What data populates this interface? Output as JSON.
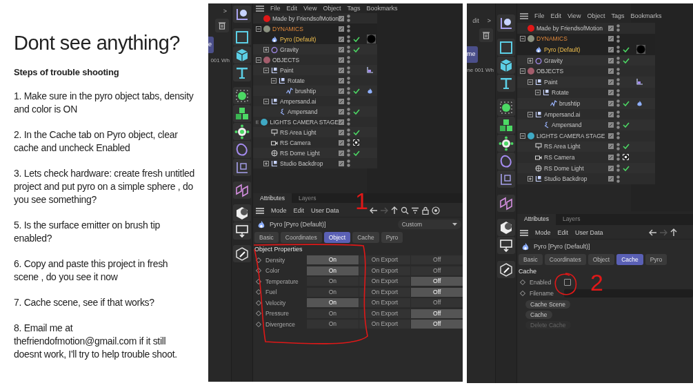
{
  "slide": {
    "title": "Dont see anything?",
    "subtitle": "Steps of trouble shooting",
    "steps": [
      "1. Make sure in the pyro object tabs, density and color is ON",
      "2. In the Cache tab on Pyro object, clear cache and uncheck Enabled",
      "3. Lets check hardware: create fresh untitled project and put pyro on a simple sphere , do you see something?",
      "5. Is the surface emitter on brush tip enabled?",
      "6. Copy and paste this project in fresh scene , do you see it now",
      "7. Cache scene, see if that works?",
      "8. Email me at thefriendofmotion@gmail.com if it still doesnt work, I'll try to help trouble shoot."
    ]
  },
  "shots": [
    {
      "strip": {
        "top": [
          ">"
        ],
        "button": "e",
        "caption": "001 Wh"
      },
      "menu": [
        "File",
        "Edit",
        "View",
        "Object",
        "Tags",
        "Bookmarks"
      ],
      "tree": [
        {
          "label": "Made by FriendsofMotion",
          "kind": "layer",
          "color": "#e01818",
          "selected": false
        },
        {
          "label": "DYNAMICS",
          "kind": "layer",
          "color": "#8b9180",
          "selected": true,
          "expanded": true,
          "children": [
            {
              "label": "Pyro (Default)",
              "kind": "flame",
              "selected": true,
              "enabled": true,
              "tags": [
                {
                  "kind": "material"
                }
              ]
            },
            {
              "label": "Gravity",
              "kind": "ring",
              "selected": false,
              "expanded": false,
              "enabled": true
            }
          ]
        },
        {
          "label": "OBJECTS",
          "kind": "layer",
          "color": "#a35d6c",
          "selected": false,
          "expanded": true,
          "children": [
            {
              "label": "Paint",
              "kind": "null",
              "selected": false,
              "expanded": true,
              "enabled": false,
              "tags": [
                {
                  "kind": "paint"
                }
              ],
              "children": [
                {
                  "label": "Rotate",
                  "kind": "null",
                  "selected": false,
                  "expanded": true,
                  "enabled": false,
                  "children": [
                    {
                      "label": "brushtip",
                      "kind": "spline",
                      "selected": false,
                      "enabled": true,
                      "tags": [
                        {
                          "kind": "flame"
                        }
                      ]
                    }
                  ]
                }
              ]
            },
            {
              "label": "Ampersand.ai",
              "kind": "null",
              "selected": false,
              "expanded": true,
              "enabled": false,
              "children": [
                {
                  "label": "Ampersand",
                  "kind": "curve",
                  "selected": false,
                  "enabled": true
                }
              ]
            }
          ]
        },
        {
          "label": "LIGHTS CAMERA STAGE",
          "kind": "layer",
          "color": "#3fa9c4",
          "selected": false,
          "expanded": true,
          "children": [
            {
              "label": "RS Area Light",
              "kind": "light",
              "selected": false,
              "enabled": true
            },
            {
              "label": "RS Camera",
              "kind": "camera",
              "selected": false,
              "enabled": false
            },
            {
              "label": "RS Dome Light",
              "kind": "globe",
              "selected": false,
              "enabled": true
            },
            {
              "label": "Studio Backdrop",
              "kind": "null",
              "selected": false,
              "expanded": false,
              "enabled": false
            }
          ]
        }
      ],
      "attributes": {
        "tabs": [
          {
            "label": "Attributes",
            "selected": true
          },
          {
            "label": "Layers",
            "selected": false
          }
        ],
        "menu": [
          "Mode",
          "Edit",
          "User Data"
        ],
        "object": "Pyro [Pyro (Default)]",
        "preset": "Custom",
        "subtabs": [
          {
            "label": "Basic",
            "selected": false
          },
          {
            "label": "Coordinates",
            "selected": false
          },
          {
            "label": "Object",
            "selected": true
          },
          {
            "label": "Cache",
            "selected": false
          },
          {
            "label": "Pyro",
            "selected": false
          }
        ],
        "section": "Object Properties",
        "rows": [
          {
            "kind": "choice",
            "label": "Density",
            "options": [
              {
                "label": "On",
                "selected": true
              },
              {
                "label": "On Export",
                "selected": false
              },
              {
                "label": "Off",
                "selected": false
              }
            ]
          },
          {
            "kind": "choice",
            "label": "Color",
            "options": [
              {
                "label": "On",
                "selected": true
              },
              {
                "label": "On Export",
                "selected": false
              },
              {
                "label": "Off",
                "selected": false
              }
            ]
          },
          {
            "kind": "choice",
            "label": "Temperature",
            "options": [
              {
                "label": "On",
                "selected": false
              },
              {
                "label": "On Export",
                "selected": false
              },
              {
                "label": "Off",
                "selected": true
              }
            ]
          },
          {
            "kind": "choice",
            "label": "Fuel",
            "options": [
              {
                "label": "On",
                "selected": false
              },
              {
                "label": "On Export",
                "selected": false
              },
              {
                "label": "Off",
                "selected": true
              }
            ]
          },
          {
            "kind": "choice",
            "label": "Velocity",
            "options": [
              {
                "label": "On",
                "selected": true
              },
              {
                "label": "On Export",
                "selected": false
              },
              {
                "label": "Off",
                "selected": false
              }
            ]
          },
          {
            "kind": "choice",
            "label": "Pressure",
            "options": [
              {
                "label": "On",
                "selected": false
              },
              {
                "label": "On Export",
                "selected": false
              },
              {
                "label": "Off",
                "selected": true
              }
            ]
          },
          {
            "kind": "choice",
            "label": "Divergence",
            "options": [
              {
                "label": "On",
                "selected": false
              },
              {
                "label": "On Export",
                "selected": false
              },
              {
                "label": "Off",
                "selected": true
              }
            ]
          }
        ]
      },
      "annotation": {
        "kind": "loop",
        "label": "1"
      }
    },
    {
      "strip": {
        "top": [
          "dit",
          ">"
        ],
        "button": "me",
        "caption": "ne 001 Wh"
      },
      "menu": [
        "File",
        "Edit",
        "View",
        "Object",
        "Tags",
        "Bookmarks"
      ],
      "tree": [
        {
          "label": "Made by FriendsofMotion",
          "kind": "layer",
          "color": "#e01818",
          "selected": false
        },
        {
          "label": "DYNAMICS",
          "kind": "layer",
          "color": "#8b9180",
          "selected": true,
          "expanded": true,
          "children": [
            {
              "label": "Pyro (Default)",
              "kind": "flame",
              "selected": true,
              "enabled": true,
              "tags": [
                {
                  "kind": "material"
                }
              ]
            },
            {
              "label": "Gravity",
              "kind": "ring",
              "selected": false,
              "expanded": false,
              "enabled": true
            }
          ]
        },
        {
          "label": "OBJECTS",
          "kind": "layer",
          "color": "#a35d6c",
          "selected": false,
          "expanded": true,
          "children": [
            {
              "label": "Paint",
              "kind": "null",
              "selected": false,
              "expanded": true,
              "enabled": false,
              "tags": [
                {
                  "kind": "paint"
                }
              ],
              "children": [
                {
                  "label": "Rotate",
                  "kind": "null",
                  "selected": false,
                  "expanded": true,
                  "enabled": false,
                  "children": [
                    {
                      "label": "brushtip",
                      "kind": "spline",
                      "selected": false,
                      "enabled": true,
                      "tags": [
                        {
                          "kind": "flame"
                        }
                      ]
                    }
                  ]
                }
              ]
            },
            {
              "label": "Ampersand.ai",
              "kind": "null",
              "selected": false,
              "expanded": true,
              "enabled": false,
              "children": [
                {
                  "label": "Ampersand",
                  "kind": "curve",
                  "selected": false,
                  "enabled": true
                }
              ]
            }
          ]
        },
        {
          "label": "LIGHTS CAMERA STAGE",
          "kind": "layer",
          "color": "#3fa9c4",
          "selected": false,
          "expanded": true,
          "children": [
            {
              "label": "RS Area Light",
              "kind": "light",
              "selected": false,
              "enabled": true
            },
            {
              "label": "RS Camera",
              "kind": "camera",
              "selected": false,
              "enabled": false
            },
            {
              "label": "RS Dome Light",
              "kind": "globe",
              "selected": false,
              "enabled": true
            },
            {
              "label": "Studio Backdrop",
              "kind": "null",
              "selected": false,
              "expanded": false,
              "enabled": false
            }
          ]
        }
      ],
      "attributes": {
        "tabs": [
          {
            "label": "Attributes",
            "selected": true
          },
          {
            "label": "Layers",
            "selected": false
          }
        ],
        "menu": [
          "Mode",
          "Edit",
          "User Data"
        ],
        "object": "Pyro [Pyro (Default)]",
        "subtabs": [
          {
            "label": "Basic",
            "selected": false
          },
          {
            "label": "Coordinates",
            "selected": false
          },
          {
            "label": "Object",
            "selected": false
          },
          {
            "label": "Cache",
            "selected": true
          },
          {
            "label": "Pyro",
            "selected": false
          }
        ],
        "section": "Cache",
        "rows": [
          {
            "kind": "checkbox",
            "label": "Enabled",
            "checked": false
          },
          {
            "kind": "text",
            "label": "Filename"
          }
        ],
        "buttons": [
          {
            "label": "Cache Scene",
            "disabled": false
          },
          {
            "label": "Cache",
            "disabled": false
          },
          {
            "label": "Delete Cache",
            "disabled": true
          }
        ]
      },
      "annotation": {
        "kind": "circle",
        "label": "2"
      }
    }
  ]
}
